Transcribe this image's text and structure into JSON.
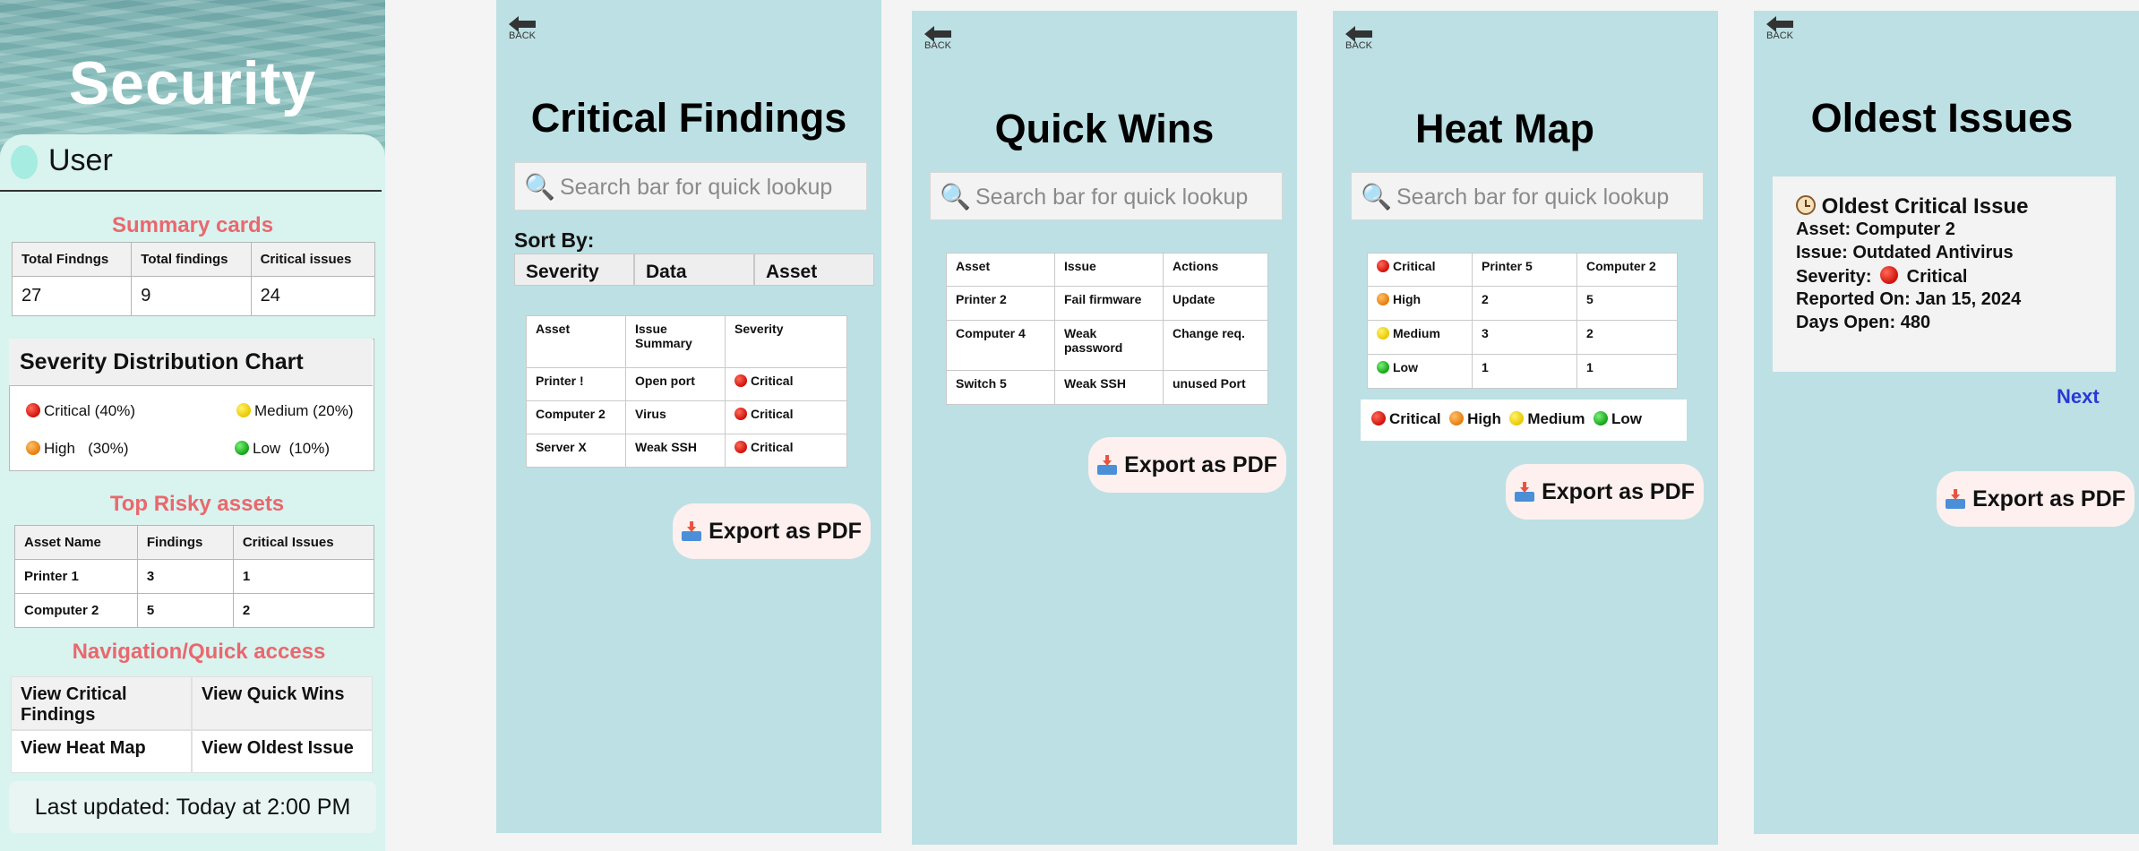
{
  "dashboard": {
    "title": "Security",
    "user_label": "User",
    "summary_heading": "Summary cards",
    "summary_headers": [
      "Total Findngs",
      "Total findings",
      "Critical issues"
    ],
    "summary_values": [
      "27",
      "9",
      "24"
    ],
    "severity_chart": {
      "title": "Severity Distribution Chart",
      "items": [
        {
          "label": "Critical (40%)",
          "color": "#d0100a",
          "percent": 40
        },
        {
          "label": "Medium (20%)",
          "color": "#e9c800",
          "percent": 20
        },
        {
          "label": "High   (30%)",
          "color": "#e67c0c",
          "percent": 30
        },
        {
          "label": "Low  (10%)",
          "color": "#13a313",
          "percent": 10
        }
      ]
    },
    "risky_heading": "Top Risky assets",
    "risky_headers": [
      "Asset Name",
      "Findings",
      "Critical Issues"
    ],
    "risky_rows": [
      [
        "Printer 1",
        "3",
        "1"
      ],
      [
        "Computer 2",
        "5",
        "2"
      ]
    ],
    "nav_heading": "Navigation/Quick access",
    "nav": {
      "critical": "View Critical Findings",
      "quick_wins": "View Quick Wins",
      "heat_map": "View Heat Map",
      "oldest": "View Oldest Issue"
    },
    "last_updated": "Last updated: Today at 2:00 PM"
  },
  "common": {
    "back_label": "BACK",
    "search_placeholder": "Search bar for quick lookup",
    "export_label": "Export as PDF"
  },
  "critical_findings": {
    "title": "Critical Findings",
    "sort_label": "Sort By:",
    "sort_options": [
      "Severity",
      "Data",
      "Asset"
    ],
    "headers": [
      "Asset",
      "Issue Summary",
      "Severity"
    ],
    "rows": [
      [
        "Printer !",
        "Open port",
        "Critical"
      ],
      [
        "Computer 2",
        "Virus",
        "Critical"
      ],
      [
        "Server X",
        "Weak SSH",
        "Critical"
      ]
    ]
  },
  "quick_wins": {
    "title": "Quick Wins",
    "headers": [
      "Asset",
      "Issue",
      "Actions"
    ],
    "rows": [
      [
        "Printer 2",
        "Fail firmware",
        "Update"
      ],
      [
        "Computer 4",
        "Weak password",
        "Change req."
      ],
      [
        "Switch 5",
        "Weak SSH",
        "unused Port"
      ]
    ]
  },
  "heat_map": {
    "title": "Heat Map",
    "headers": [
      "Critical",
      "Printer 5",
      "Computer 2"
    ],
    "rows": [
      [
        "High",
        "2",
        "5"
      ],
      [
        "Medium",
        "3",
        "2"
      ],
      [
        "Low",
        "1",
        "1"
      ]
    ],
    "legend": [
      "Critical",
      "High",
      "Medium",
      "Low"
    ]
  },
  "oldest_issues": {
    "title": "Oldest Issues",
    "card_title": "Oldest Critical Issue",
    "asset": "Asset: Computer 2",
    "issue": "Issue: Outdated Antivirus",
    "severity_prefix": "Severity:",
    "severity_value": "Critical",
    "reported": "Reported On: Jan 15, 2024",
    "days_open": "Days Open: 480",
    "next_label": "Next"
  },
  "icons": {
    "search": "magnifying-glass",
    "export": "inbox-tray",
    "back": "left-arrow",
    "oldest": "mantelpiece-clock",
    "user": "avatar-circle"
  }
}
